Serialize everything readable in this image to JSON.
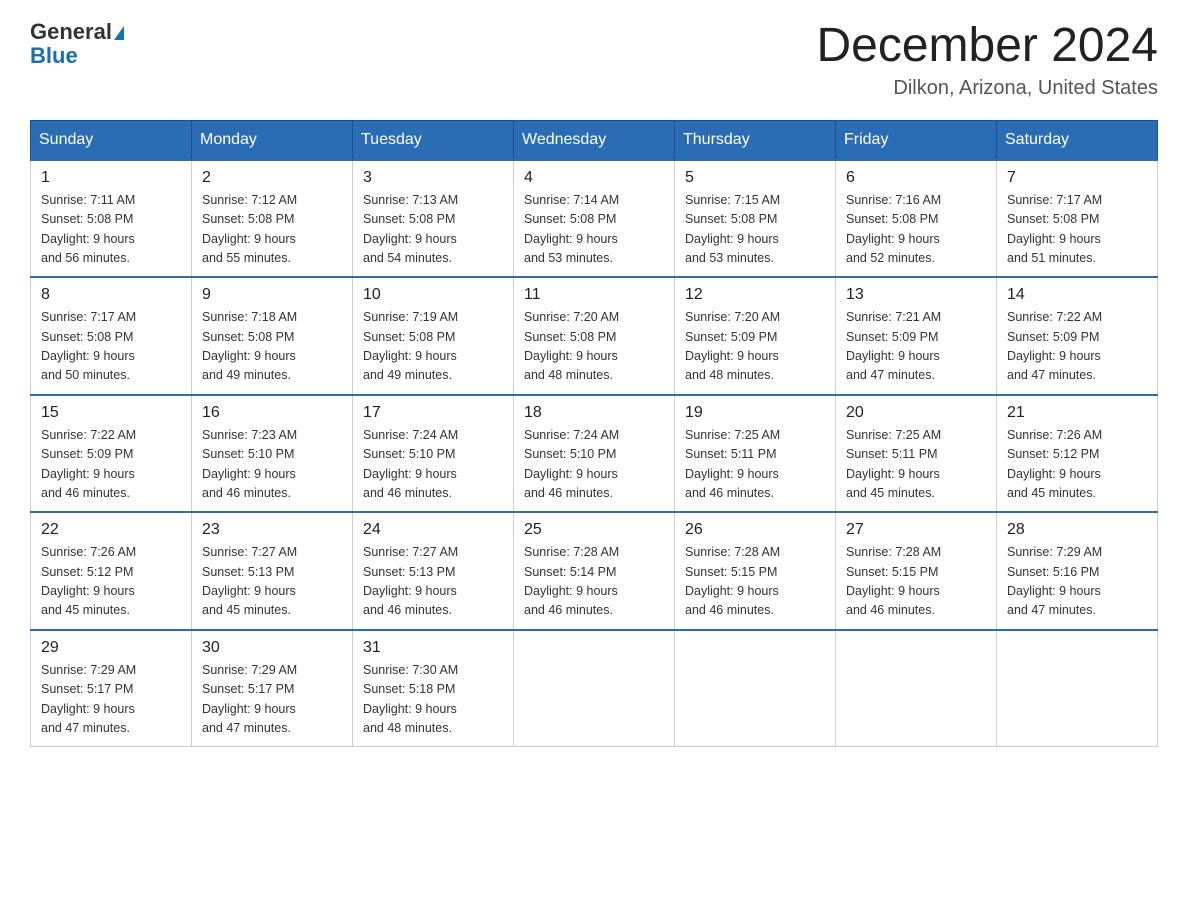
{
  "header": {
    "logo_general": "General",
    "logo_blue": "Blue",
    "month_title": "December 2024",
    "location": "Dilkon, Arizona, United States"
  },
  "days_of_week": [
    "Sunday",
    "Monday",
    "Tuesday",
    "Wednesday",
    "Thursday",
    "Friday",
    "Saturday"
  ],
  "weeks": [
    [
      {
        "day": "1",
        "sunrise": "7:11 AM",
        "sunset": "5:08 PM",
        "daylight": "9 hours and 56 minutes."
      },
      {
        "day": "2",
        "sunrise": "7:12 AM",
        "sunset": "5:08 PM",
        "daylight": "9 hours and 55 minutes."
      },
      {
        "day": "3",
        "sunrise": "7:13 AM",
        "sunset": "5:08 PM",
        "daylight": "9 hours and 54 minutes."
      },
      {
        "day": "4",
        "sunrise": "7:14 AM",
        "sunset": "5:08 PM",
        "daylight": "9 hours and 53 minutes."
      },
      {
        "day": "5",
        "sunrise": "7:15 AM",
        "sunset": "5:08 PM",
        "daylight": "9 hours and 53 minutes."
      },
      {
        "day": "6",
        "sunrise": "7:16 AM",
        "sunset": "5:08 PM",
        "daylight": "9 hours and 52 minutes."
      },
      {
        "day": "7",
        "sunrise": "7:17 AM",
        "sunset": "5:08 PM",
        "daylight": "9 hours and 51 minutes."
      }
    ],
    [
      {
        "day": "8",
        "sunrise": "7:17 AM",
        "sunset": "5:08 PM",
        "daylight": "9 hours and 50 minutes."
      },
      {
        "day": "9",
        "sunrise": "7:18 AM",
        "sunset": "5:08 PM",
        "daylight": "9 hours and 49 minutes."
      },
      {
        "day": "10",
        "sunrise": "7:19 AM",
        "sunset": "5:08 PM",
        "daylight": "9 hours and 49 minutes."
      },
      {
        "day": "11",
        "sunrise": "7:20 AM",
        "sunset": "5:08 PM",
        "daylight": "9 hours and 48 minutes."
      },
      {
        "day": "12",
        "sunrise": "7:20 AM",
        "sunset": "5:09 PM",
        "daylight": "9 hours and 48 minutes."
      },
      {
        "day": "13",
        "sunrise": "7:21 AM",
        "sunset": "5:09 PM",
        "daylight": "9 hours and 47 minutes."
      },
      {
        "day": "14",
        "sunrise": "7:22 AM",
        "sunset": "5:09 PM",
        "daylight": "9 hours and 47 minutes."
      }
    ],
    [
      {
        "day": "15",
        "sunrise": "7:22 AM",
        "sunset": "5:09 PM",
        "daylight": "9 hours and 46 minutes."
      },
      {
        "day": "16",
        "sunrise": "7:23 AM",
        "sunset": "5:10 PM",
        "daylight": "9 hours and 46 minutes."
      },
      {
        "day": "17",
        "sunrise": "7:24 AM",
        "sunset": "5:10 PM",
        "daylight": "9 hours and 46 minutes."
      },
      {
        "day": "18",
        "sunrise": "7:24 AM",
        "sunset": "5:10 PM",
        "daylight": "9 hours and 46 minutes."
      },
      {
        "day": "19",
        "sunrise": "7:25 AM",
        "sunset": "5:11 PM",
        "daylight": "9 hours and 46 minutes."
      },
      {
        "day": "20",
        "sunrise": "7:25 AM",
        "sunset": "5:11 PM",
        "daylight": "9 hours and 45 minutes."
      },
      {
        "day": "21",
        "sunrise": "7:26 AM",
        "sunset": "5:12 PM",
        "daylight": "9 hours and 45 minutes."
      }
    ],
    [
      {
        "day": "22",
        "sunrise": "7:26 AM",
        "sunset": "5:12 PM",
        "daylight": "9 hours and 45 minutes."
      },
      {
        "day": "23",
        "sunrise": "7:27 AM",
        "sunset": "5:13 PM",
        "daylight": "9 hours and 45 minutes."
      },
      {
        "day": "24",
        "sunrise": "7:27 AM",
        "sunset": "5:13 PM",
        "daylight": "9 hours and 46 minutes."
      },
      {
        "day": "25",
        "sunrise": "7:28 AM",
        "sunset": "5:14 PM",
        "daylight": "9 hours and 46 minutes."
      },
      {
        "day": "26",
        "sunrise": "7:28 AM",
        "sunset": "5:15 PM",
        "daylight": "9 hours and 46 minutes."
      },
      {
        "day": "27",
        "sunrise": "7:28 AM",
        "sunset": "5:15 PM",
        "daylight": "9 hours and 46 minutes."
      },
      {
        "day": "28",
        "sunrise": "7:29 AM",
        "sunset": "5:16 PM",
        "daylight": "9 hours and 47 minutes."
      }
    ],
    [
      {
        "day": "29",
        "sunrise": "7:29 AM",
        "sunset": "5:17 PM",
        "daylight": "9 hours and 47 minutes."
      },
      {
        "day": "30",
        "sunrise": "7:29 AM",
        "sunset": "5:17 PM",
        "daylight": "9 hours and 47 minutes."
      },
      {
        "day": "31",
        "sunrise": "7:30 AM",
        "sunset": "5:18 PM",
        "daylight": "9 hours and 48 minutes."
      },
      null,
      null,
      null,
      null
    ]
  ],
  "labels": {
    "sunrise": "Sunrise:",
    "sunset": "Sunset:",
    "daylight": "Daylight:"
  }
}
